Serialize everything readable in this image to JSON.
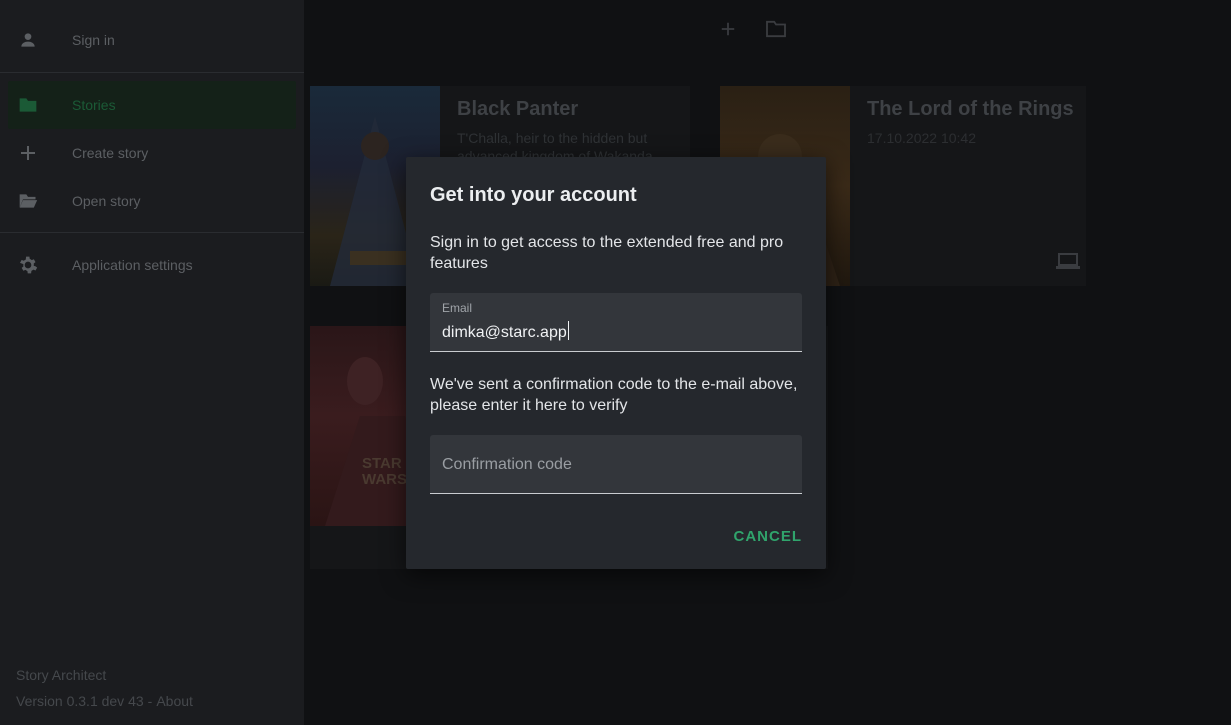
{
  "sidebar": {
    "items": [
      {
        "label": "Sign in",
        "icon": "person-icon"
      },
      {
        "label": "Stories",
        "icon": "folder-icon"
      },
      {
        "label": "Create story",
        "icon": "plus-icon"
      },
      {
        "label": "Open story",
        "icon": "folder-open-icon"
      },
      {
        "label": "Application settings",
        "icon": "gear-icon"
      }
    ],
    "footer": {
      "app_name": "Story Architect",
      "version": "Version 0.3.1 dev 43",
      "separator": "-",
      "about": "About"
    }
  },
  "toolbar": {
    "icons": [
      "plus-icon",
      "folder-icon"
    ]
  },
  "stories": [
    {
      "title": "Black Panter",
      "description": "T'Challa, heir to the hidden but advanced kingdom of Wakanda"
    },
    {
      "title": "The Lord of the Rings",
      "date": "17.10.2022 10:42"
    },
    {
      "poster_text": "STAR WARS"
    }
  ],
  "dialog": {
    "title": "Get into your account",
    "intro": "Sign in to get access to the extended free and pro features",
    "email_label": "Email",
    "email_value": "dimka@starc.app",
    "confirmation_text": "We've sent a confirmation code to the e-mail above, please enter it here to verify",
    "code_placeholder": "Confirmation code",
    "cancel_label": "CANCEL"
  },
  "colors": {
    "accent": "#30a46c",
    "dialog_bg": "#25282d",
    "sidebar_bg": "#1b1c1f"
  }
}
